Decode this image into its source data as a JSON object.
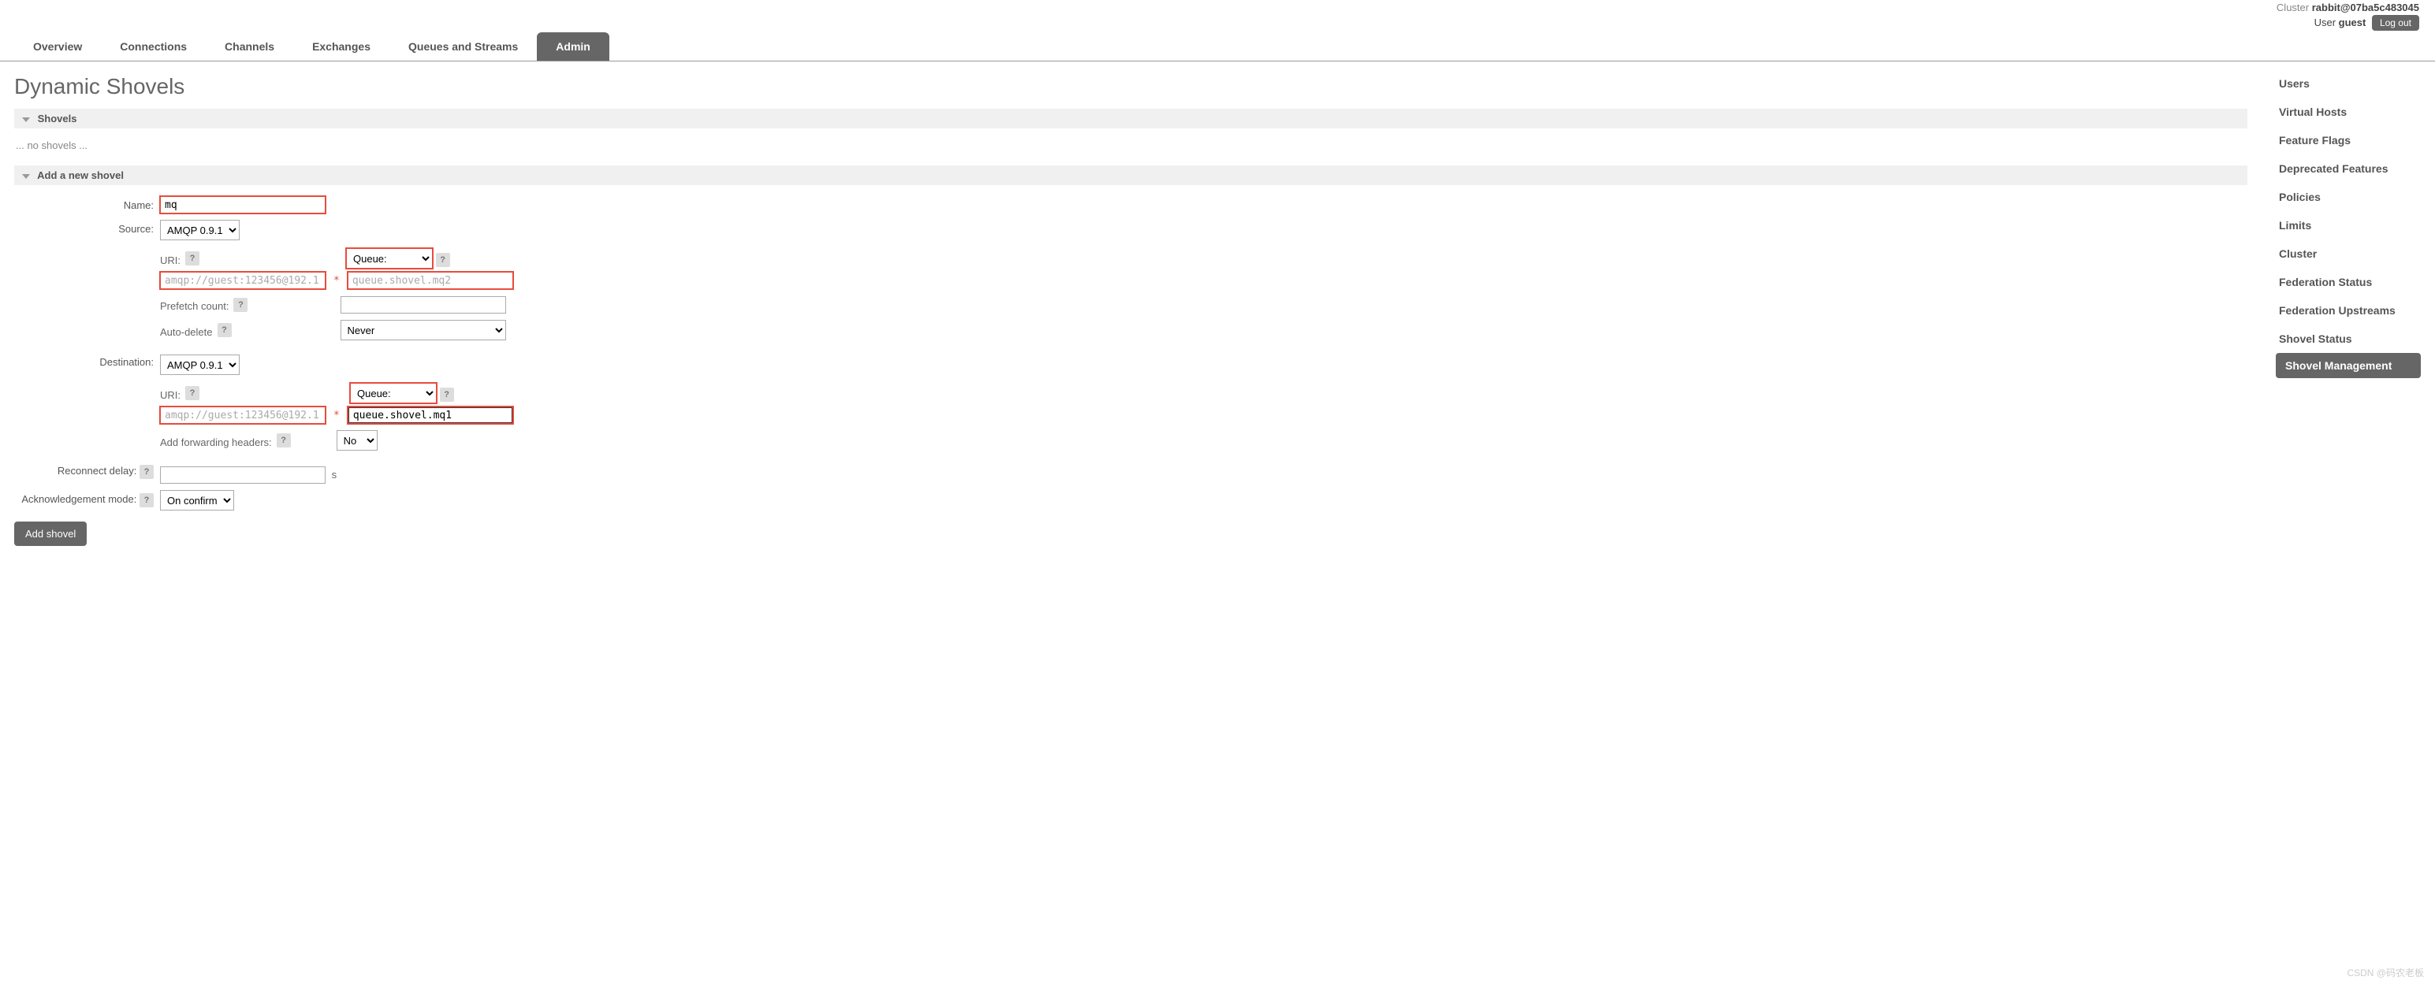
{
  "header": {
    "cluster_label": "Cluster",
    "cluster_name": "rabbit@07ba5c483045",
    "user_label": "User",
    "user_name": "guest",
    "logout": "Log out"
  },
  "tabs": [
    {
      "label": "Overview",
      "active": false
    },
    {
      "label": "Connections",
      "active": false
    },
    {
      "label": "Channels",
      "active": false
    },
    {
      "label": "Exchanges",
      "active": false
    },
    {
      "label": "Queues and Streams",
      "active": false
    },
    {
      "label": "Admin",
      "active": true
    }
  ],
  "page_title": "Dynamic Shovels",
  "sections": {
    "shovels_header": "Shovels",
    "no_shovels": "... no shovels ...",
    "add_header": "Add a new shovel"
  },
  "form": {
    "name_label": "Name:",
    "name_value": "mq",
    "source_label": "Source:",
    "source_protocol": "AMQP 0.9.1",
    "uri_label": "URI:",
    "help_glyph": "?",
    "mandatory": "*",
    "source_uri_placeholder": "amqp://guest:123456@192.1",
    "source_target_type": "Queue:",
    "source_target_value": "queue.shovel.mq2",
    "prefetch_label": "Prefetch count:",
    "prefetch_value": "",
    "autodelete_label": "Auto-delete",
    "autodelete_value": "Never",
    "dest_label": "Destination:",
    "dest_protocol": "AMQP 0.9.1",
    "dest_uri_placeholder": "amqp://guest:123456@192.1",
    "dest_target_type": "Queue:",
    "dest_target_value": "queue.shovel.mq1",
    "forward_label": "Add forwarding headers:",
    "forward_value": "No",
    "reconnect_label": "Reconnect delay:",
    "reconnect_value": "",
    "reconnect_unit": "s",
    "ack_label": "Acknowledgement mode:",
    "ack_value": "On confirm",
    "submit": "Add shovel"
  },
  "sidebar": {
    "items": [
      {
        "label": "Users"
      },
      {
        "label": "Virtual Hosts"
      },
      {
        "label": "Feature Flags"
      },
      {
        "label": "Deprecated Features"
      },
      {
        "label": "Policies"
      },
      {
        "label": "Limits"
      },
      {
        "label": "Cluster"
      },
      {
        "label": "Federation Status"
      },
      {
        "label": "Federation Upstreams"
      },
      {
        "label": "Shovel Status"
      },
      {
        "label": "Shovel Management"
      }
    ],
    "active_index": 10
  },
  "watermark": "CSDN @码农老板"
}
